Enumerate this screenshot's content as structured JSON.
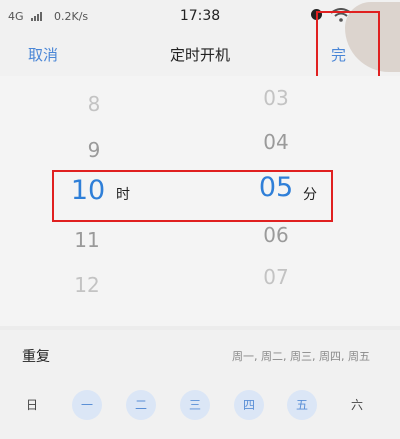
{
  "status_bar": {
    "network": "4G",
    "speed": "0.2K/s",
    "time": "17:38"
  },
  "header": {
    "cancel_label": "取消",
    "title": "定时开机",
    "done_label": "完"
  },
  "picker": {
    "hours": [
      "8",
      "9",
      "10",
      "11",
      "12"
    ],
    "selected_hour": "10",
    "hour_unit": "时",
    "minutes": [
      "03",
      "04",
      "05",
      "06",
      "07"
    ],
    "selected_minute": "05",
    "minute_unit": "分"
  },
  "repeat": {
    "label": "重复",
    "summary": "周一, 周二, 周三, 周四, 周五",
    "days": [
      {
        "label": "日",
        "selected": false
      },
      {
        "label": "一",
        "selected": true
      },
      {
        "label": "二",
        "selected": true
      },
      {
        "label": "三",
        "selected": true
      },
      {
        "label": "四",
        "selected": true
      },
      {
        "label": "五",
        "selected": true
      },
      {
        "label": "六",
        "selected": false
      }
    ]
  },
  "icons": [
    "signal-bars-icon",
    "alarm-icon",
    "wifi-icon"
  ],
  "colors": {
    "accent": "#2f7fd8",
    "link": "#4a86d6",
    "highlight_box": "#e02020",
    "day_selected_bg": "#dbe6f6"
  }
}
